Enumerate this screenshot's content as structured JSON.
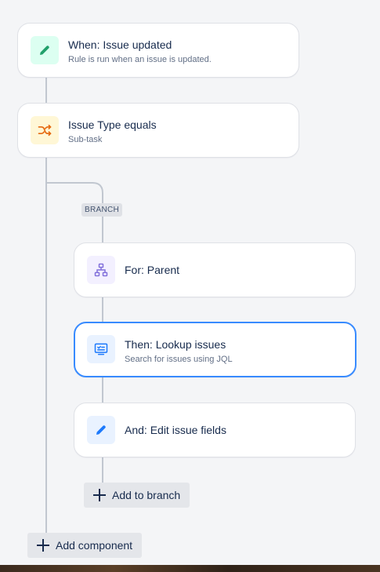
{
  "colors": {
    "background": "#f4f5f7",
    "connector": "#c1c7d0",
    "selected_border": "#388bff",
    "trigger_icon_bg": "#dcfff1",
    "trigger_icon": "#22a06b",
    "condition_icon_bg": "#fff7d6",
    "condition_icon": "#e56910",
    "branch_icon_bg": "#f3f0ff",
    "branch_icon": "#8270db",
    "action_icon_bg": "#e9f2ff",
    "action_icon": "#1d7afc"
  },
  "trigger": {
    "icon": "pencil-icon",
    "title": "When: Issue updated",
    "subtitle": "Rule is run when an issue is updated."
  },
  "condition": {
    "icon": "shuffle-icon",
    "title": "Issue Type equals",
    "subtitle": "Sub-task"
  },
  "branch": {
    "label": "BRANCH",
    "for_card": {
      "icon": "hierarchy-icon",
      "title": "For: Parent"
    },
    "lookup_card": {
      "icon": "monitor-list-icon",
      "title": "Then: Lookup issues",
      "subtitle": "Search for issues using JQL"
    },
    "edit_card": {
      "icon": "pencil-icon",
      "title": "And: Edit issue fields"
    },
    "add_to_branch_label": "Add to branch"
  },
  "add_component_label": "Add component"
}
